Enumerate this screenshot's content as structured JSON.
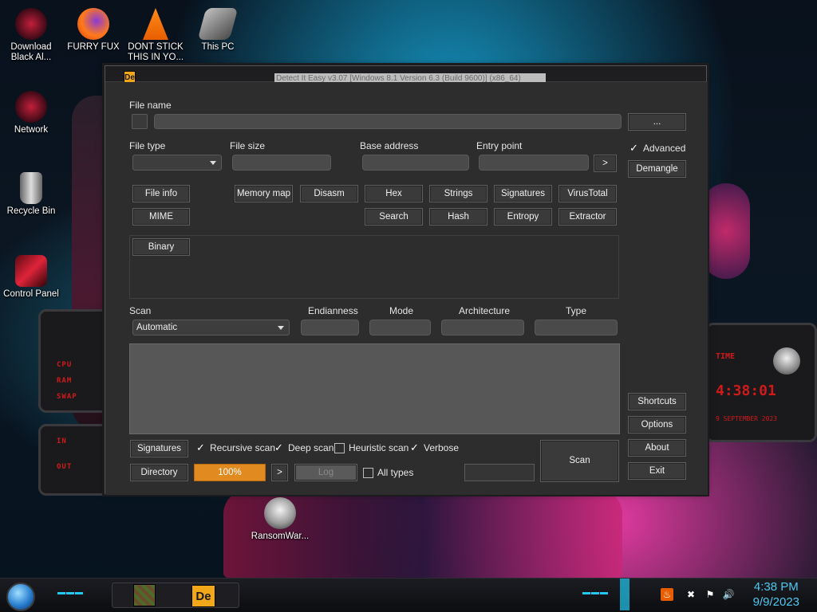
{
  "desktop_icons": [
    {
      "label": "Download Black Al...",
      "icon": "alienware-download-icon"
    },
    {
      "label": "FURRY FUX",
      "icon": "firefox-icon"
    },
    {
      "label": "DONT STICK THIS IN YO...",
      "icon": "vlc-cone-icon"
    },
    {
      "label": "This PC",
      "icon": "this-pc-icon"
    },
    {
      "label": "Network",
      "icon": "network-icon"
    },
    {
      "label": "Recycle Bin",
      "icon": "recycle-bin-icon"
    },
    {
      "label": "Control Panel",
      "icon": "control-panel-icon"
    },
    {
      "label": "RansomWar...",
      "icon": "skull-icon"
    }
  ],
  "widgets": {
    "cpu_label": "CPU",
    "ram_label": "RAM",
    "swap_label": "SWAP",
    "in_label": "IN",
    "out_label": "OUT",
    "time_label": "TIME",
    "time_value": "4:38:01",
    "date_strip": "9 SEPTEMBER 2023"
  },
  "window": {
    "title": "Detect It Easy v3.07 [Windows 8.1 Version 6.3 (Build 9600)] (x86_64)",
    "icon_text": "De",
    "file_name_label": "File name",
    "file_name_value": "",
    "browse_button": "...",
    "file_type_label": "File type",
    "file_type_value": "",
    "file_size_label": "File size",
    "file_size_value": "",
    "base_address_label": "Base address",
    "base_address_value": "",
    "entry_point_label": "Entry point",
    "entry_point_value": "",
    "entry_point_go": ">",
    "advanced_label": "Advanced",
    "advanced_checked": true,
    "demangle_button": "Demangle",
    "buttons_row1": [
      "File info",
      "Memory map",
      "Disasm",
      "Hex",
      "Strings",
      "Signatures",
      "VirusTotal"
    ],
    "buttons_row2": [
      "MIME",
      "Search",
      "Hash",
      "Entropy",
      "Extractor"
    ],
    "binary_button": "Binary",
    "scan_label": "Scan",
    "scan_mode_value": "Automatic",
    "endianness_label": "Endianness",
    "mode_label": "Mode",
    "architecture_label": "Architecture",
    "type_label": "Type",
    "shortcuts_button": "Shortcuts",
    "options_button": "Options",
    "about_button": "About",
    "exit_button": "Exit",
    "signatures_button": "Signatures",
    "recursive_scan_label": "Recursive scan",
    "deep_scan_label": "Deep scan",
    "heuristic_scan_label": "Heuristic scan",
    "verbose_label": "Verbose",
    "recursive_scan_checked": true,
    "deep_scan_checked": true,
    "heuristic_scan_checked": false,
    "verbose_checked": true,
    "directory_button": "Directory",
    "progress_text": "100%",
    "progress_value": 100,
    "next_button": ">",
    "log_button": "Log",
    "all_types_label": "All types",
    "all_types_checked": false,
    "scan_button": "Scan"
  },
  "taskbar": {
    "clock_time": "4:38 PM",
    "clock_date": "9/9/2023",
    "tray_icons": [
      "java-icon",
      "network-error-icon",
      "flag-icon",
      "volume-icon"
    ],
    "pinned_apps": [
      "minecraft-icon",
      "detect-it-easy-icon"
    ]
  },
  "colors": {
    "accent_cyan": "#22c8f0",
    "progress_orange": "#e08a20",
    "widget_red": "#d01a1a"
  }
}
